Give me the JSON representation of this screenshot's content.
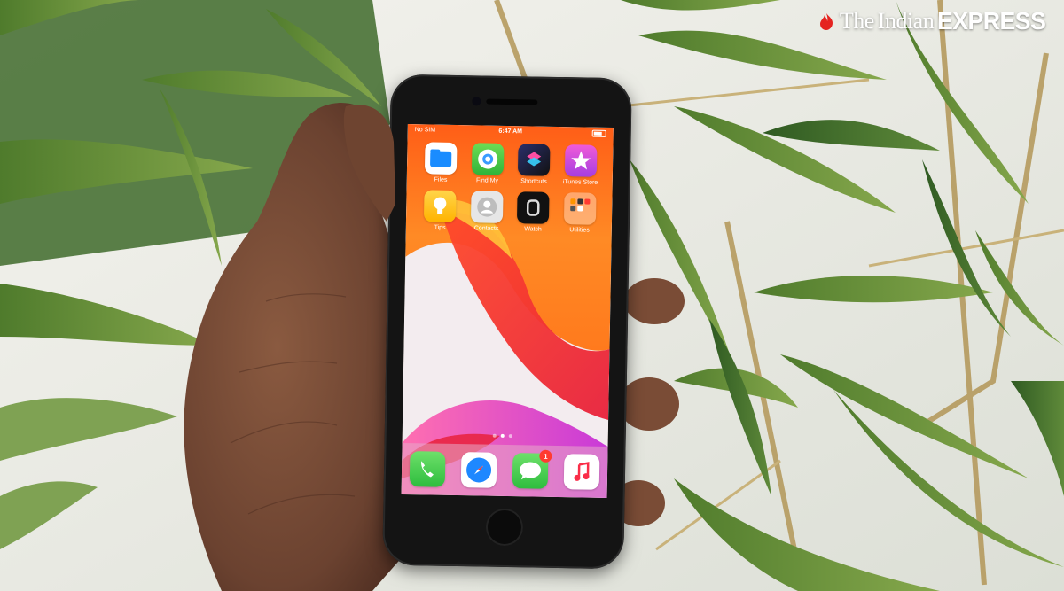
{
  "watermark": {
    "the": "The",
    "indian": "Indian",
    "express": "EXPRESS"
  },
  "phone": {
    "status_bar": {
      "carrier": "No SIM",
      "time": "6:47 AM"
    },
    "apps": [
      {
        "label": "Files",
        "icon": "files-icon"
      },
      {
        "label": "Find My",
        "icon": "find-my-icon"
      },
      {
        "label": "Shortcuts",
        "icon": "shortcuts-icon"
      },
      {
        "label": "iTunes Store",
        "icon": "itunes-store-icon"
      },
      {
        "label": "Tips",
        "icon": "tips-icon"
      },
      {
        "label": "Contacts",
        "icon": "contacts-icon"
      },
      {
        "label": "Watch",
        "icon": "watch-icon"
      },
      {
        "label": "Utilities",
        "icon": "utilities-folder-icon"
      }
    ],
    "dock": [
      {
        "icon": "phone-icon"
      },
      {
        "icon": "safari-icon"
      },
      {
        "icon": "messages-icon",
        "badge": "1"
      },
      {
        "icon": "music-icon"
      }
    ]
  },
  "colors": {
    "foliage": "#5f8a3a",
    "wallpaper_orange": "#ff6a1a",
    "wallpaper_red": "#e8213b",
    "badge_red": "#ff3b30"
  }
}
